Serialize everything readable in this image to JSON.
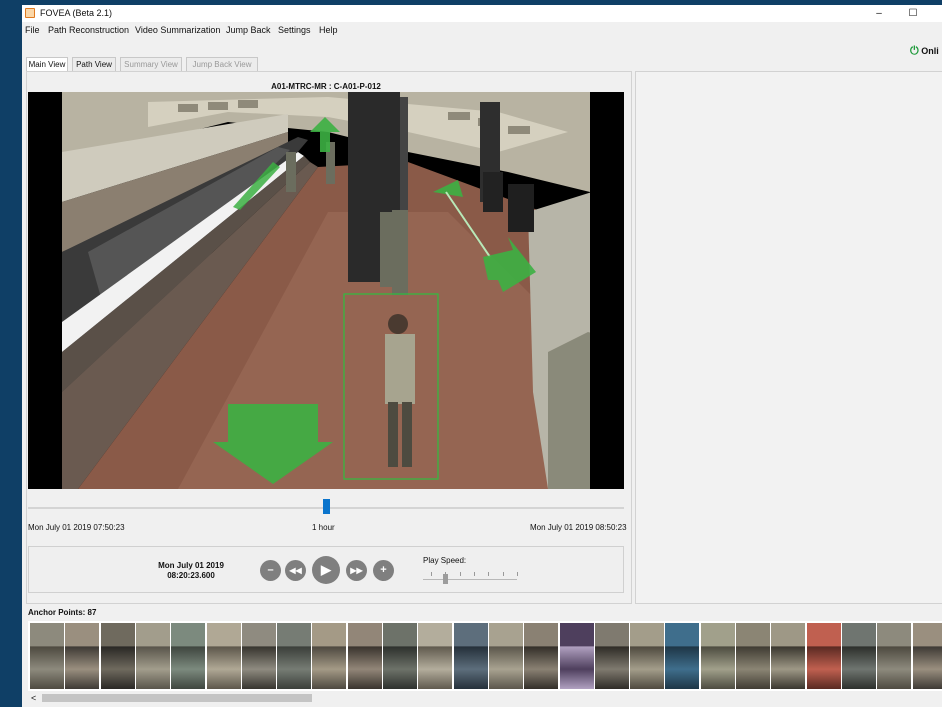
{
  "window": {
    "title": "FOVEA (Beta 2.1)",
    "minimize": "–",
    "maximize": "☐"
  },
  "menu": [
    "File",
    "Path Reconstruction",
    "Video Summarization",
    "Jump Back",
    "Settings",
    "Help"
  ],
  "status": {
    "icon": "power-icon",
    "label": "Onli"
  },
  "tabs": [
    {
      "label": "Main View",
      "active": true
    },
    {
      "label": "Path View",
      "active": false
    },
    {
      "label": "Summary View",
      "active": false
    },
    {
      "label": "Jump Back View",
      "active": false
    }
  ],
  "camera": {
    "id": "A01-MTRC-MR : C-A01-P-012"
  },
  "timeline": {
    "start": "Mon July 01 2019 07:50:23",
    "span": "1 hour",
    "end": "Mon July 01 2019 08:50:23",
    "position_fraction": 0.5
  },
  "playback": {
    "date": "Mon July 01 2019",
    "time": "08:20:23.600",
    "buttons": {
      "zoom_out": "–",
      "rewind": "◀◀",
      "play": "▶",
      "fast_forward": "▶▶",
      "zoom_in": "+"
    },
    "speed_label": "Play Speed:",
    "speed_level": 2,
    "speed_steps": 7
  },
  "anchor_points": {
    "label": "Anchor Points: 87",
    "count": 87
  },
  "scrollbar": {
    "left_arrow": "<"
  },
  "colors": {
    "accent": "#0a74cc",
    "arrow_green": "#3cb043",
    "online": "#1e9a3a",
    "bbox": "#2fbf3f"
  }
}
